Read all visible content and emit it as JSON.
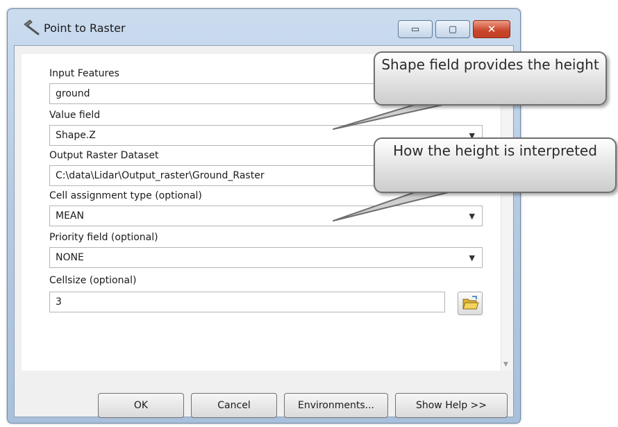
{
  "window": {
    "title": "Point to Raster",
    "controls": {
      "minimize": "▭",
      "maximize": "▢",
      "close": "✕"
    }
  },
  "form": {
    "input_features": {
      "label": "Input Features",
      "value": "ground"
    },
    "value_field": {
      "label": "Value field",
      "value": "Shape.Z"
    },
    "output_raster": {
      "label": "Output Raster Dataset",
      "value": "C:\\data\\Lidar\\Output_raster\\Ground_Raster"
    },
    "cell_assignment": {
      "label": "Cell assignment type (optional)",
      "value": "MEAN"
    },
    "priority_field": {
      "label": "Priority field (optional)",
      "value": "NONE"
    },
    "cellsize": {
      "label": "Cellsize (optional)",
      "value": "3"
    }
  },
  "buttons": {
    "ok": "OK",
    "cancel": "Cancel",
    "environments": "Environments...",
    "show_help": "Show Help >>"
  },
  "callouts": {
    "shape_field": "Shape field provides the height",
    "interpretation": "How the height is interpreted"
  },
  "icons": {
    "title": "tool-hammer-icon",
    "browse": "open-folder-icon",
    "dropdown": "chevron-down-icon"
  },
  "colors": {
    "title_bar": "#b6cbe3",
    "close_button": "#c9452a",
    "callout_border": "#6f6f6f"
  }
}
